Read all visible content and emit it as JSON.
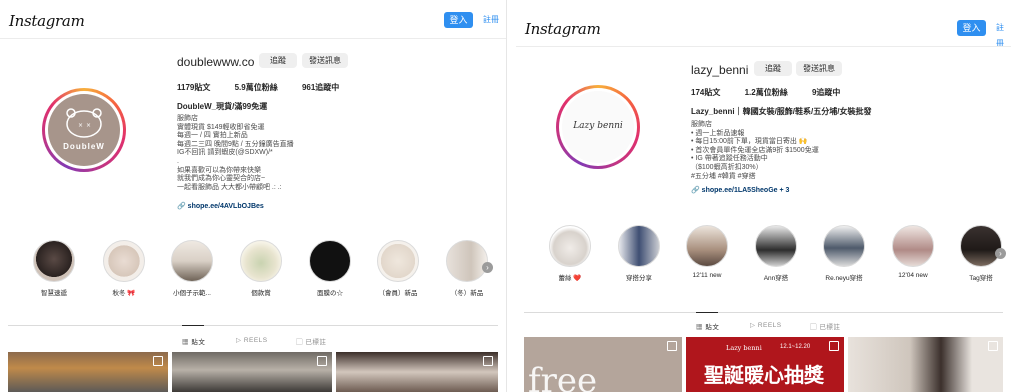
{
  "left": {
    "logo": "Instagram",
    "login": "登入",
    "signup": "註冊",
    "username": "doublewww.co",
    "follow": "追蹤",
    "message": "發送訊息",
    "stats": [
      "1179貼文",
      "5.9萬位粉絲",
      "961追蹤中"
    ],
    "avatar_text": "DoubleW",
    "full_name": "DoubleW_現貨/滿99免運",
    "bio": "服飾店\n實體現貨 $149輕收即省免運\n每週一 / 四 實拍上新品\n每週二三四 晚間9點 / 五分鐘廣告直播\nIG不回訊 請到蝦皮(@SDXW)/*\n.\n如果喜歡可以為你帶來快樂\n就我們成為你心靈契合的店~\n一起看服飾品 大大都小帶顧吧 .: .:",
    "link": "shope.ee/4AVLbOJBes",
    "highlights": [
      "智慧速遞",
      "秋冬 🎀",
      "小個子示範...",
      "個款賞",
      "面膜の☆",
      "（會員）新品",
      "（冬）新品"
    ],
    "tabs": [
      "貼文",
      "REELS",
      "已標註"
    ]
  },
  "right": {
    "logo": "Instagram",
    "login": "登入",
    "signup": "註冊",
    "username": "lazy_benni",
    "follow": "追蹤",
    "message": "發送訊息",
    "stats": [
      "174貼文",
      "1.2萬位粉絲",
      "9追蹤中"
    ],
    "avatar_text": "Lazy benni",
    "full_name": "Lazy_benni｜韓國女裝/服飾/鞋系/五分埔/女裝批發",
    "bio": "服飾店\n• 週一上新品速報\n• 每日15:00前下單，現貨當日寄出 🙌\n• 首次會員單件免運全店滿9折 $1500免運\n• IG 帶著追蹤任務活動中\n（$100蝦高折扣30%）\n#五分埔 #韓貨 #穿搭",
    "link": "shope.ee/1LA5SheoGe + 3",
    "highlights": [
      "蕾絲 ❤️",
      "穿搭分享",
      "12'11 new",
      "Ann穿搭",
      "Re.neyu穿搭",
      "12'04 new",
      "Tag穿搭"
    ],
    "tabs": [
      "貼文",
      "REELS",
      "已標註"
    ],
    "post_texts": [
      "free",
      "Lazy benni",
      "12.1~12.20",
      "聖誕暖心抽獎"
    ]
  },
  "colors": {
    "accent": "#2f8ff0",
    "ring": "#e1306c"
  }
}
